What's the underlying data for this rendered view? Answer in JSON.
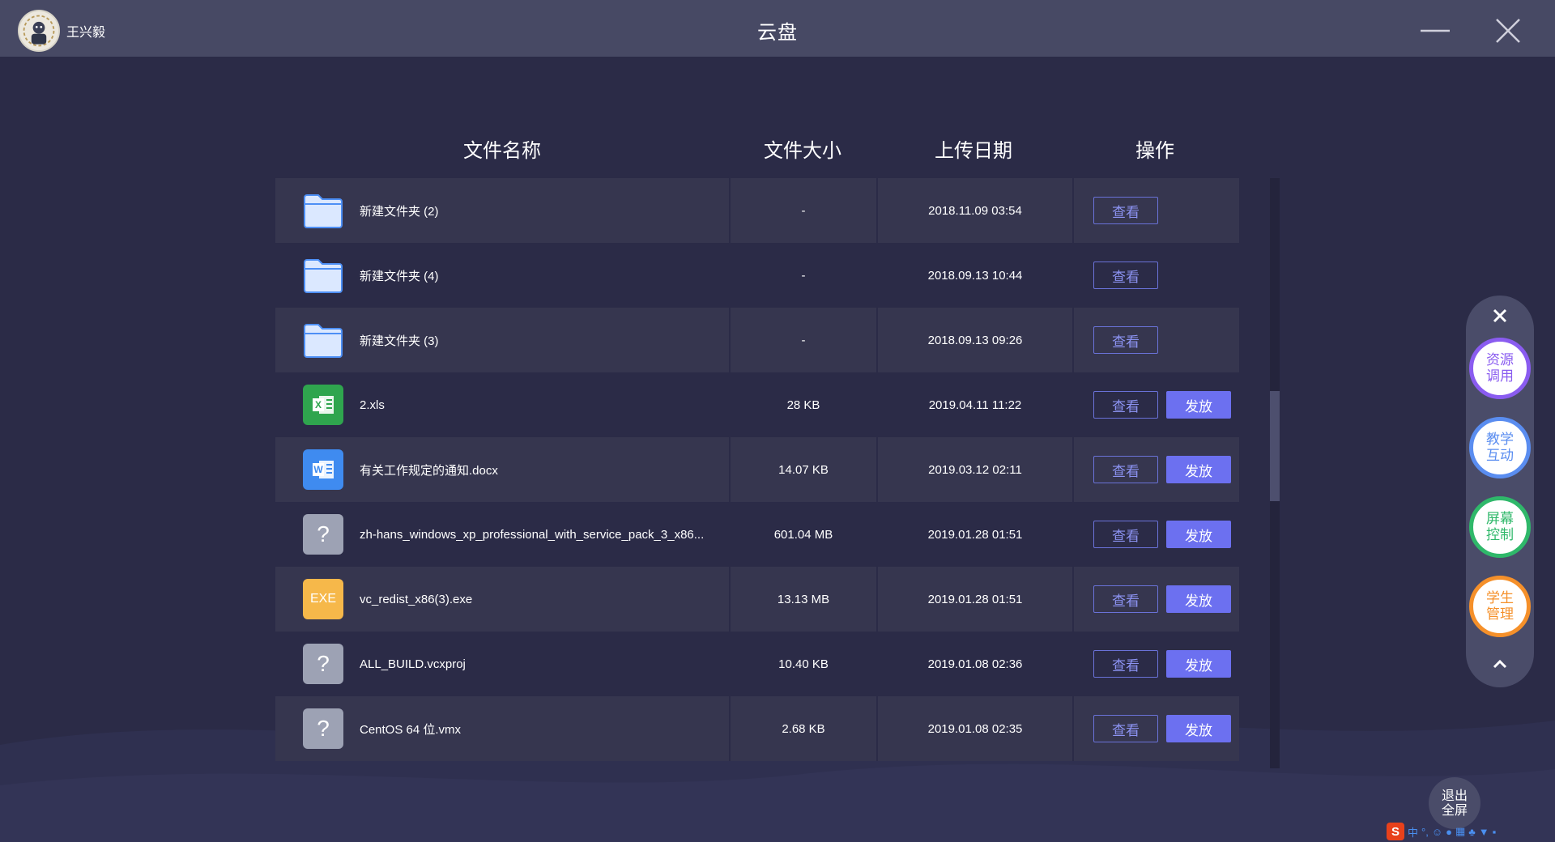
{
  "window": {
    "title": "云盘",
    "username": "王兴毅"
  },
  "table": {
    "headers": {
      "name": "文件名称",
      "size": "文件大小",
      "date": "上传日期",
      "op": "操作"
    },
    "rows": [
      {
        "name": "新建文件夹 (2)",
        "size": "-",
        "date": "2018.11.09 03:54",
        "icon": "folder-icon",
        "view": "查看",
        "send": null
      },
      {
        "name": "新建文件夹 (4)",
        "size": "-",
        "date": "2018.09.13 10:44",
        "icon": "folder-icon",
        "view": "查看",
        "send": null
      },
      {
        "name": "新建文件夹 (3)",
        "size": "-",
        "date": "2018.09.13 09:26",
        "icon": "folder-icon",
        "view": "查看",
        "send": null
      },
      {
        "name": "2.xls",
        "size": "28 KB",
        "date": "2019.04.11 11:22",
        "icon": "excel-icon",
        "view": "查看",
        "send": "发放"
      },
      {
        "name": "有关工作规定的通知.docx",
        "size": "14.07 KB",
        "date": "2019.03.12 02:11",
        "icon": "word-icon",
        "view": "查看",
        "send": "发放"
      },
      {
        "name": "zh-hans_windows_xp_professional_with_service_pack_3_x86...",
        "size": "601.04 MB",
        "date": "2019.01.28 01:51",
        "icon": "unknown-file-icon",
        "view": "查看",
        "send": "发放"
      },
      {
        "name": "vc_redist_x86(3).exe",
        "size": "13.13 MB",
        "date": "2019.01.28 01:51",
        "icon": "exe-icon",
        "icon_text": "EXE",
        "view": "查看",
        "send": "发放"
      },
      {
        "name": "ALL_BUILD.vcxproj",
        "size": "10.40 KB",
        "date": "2019.01.08 02:36",
        "icon": "unknown-file-icon",
        "view": "查看",
        "send": "发放"
      },
      {
        "name": "CentOS 64 位.vmx",
        "size": "2.68 KB",
        "date": "2019.01.08 02:35",
        "icon": "unknown-file-icon",
        "view": "查看",
        "send": "发放"
      }
    ]
  },
  "sidebar": {
    "items": [
      {
        "label": "资源调用",
        "color": "#8a5cf0"
      },
      {
        "label": "教学互动",
        "color": "#5a8df0"
      },
      {
        "label": "屏幕控制",
        "color": "#2fb86a"
      },
      {
        "label": "学生管理",
        "color": "#f5902a"
      }
    ]
  },
  "exit_fullscreen": "退出全屏",
  "ime": {
    "logo": "S",
    "mode": "中",
    "punct": "°,"
  },
  "colors": {
    "titlebar": "#474964",
    "background": "#2b2b47",
    "row_alt": "#36364f",
    "accent": "#6c70f0"
  }
}
